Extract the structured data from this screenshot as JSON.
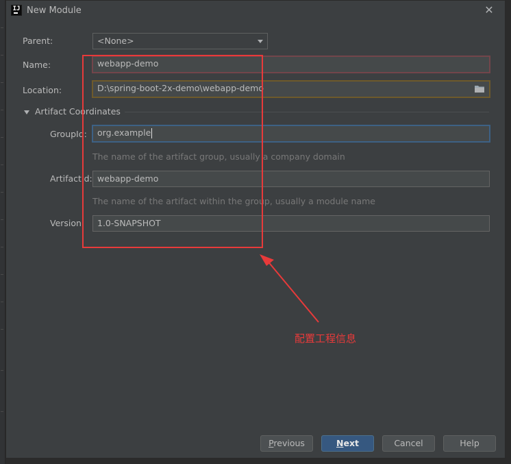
{
  "window": {
    "title": "New Module"
  },
  "form": {
    "parent_label": "Parent:",
    "parent_value": "<None>",
    "name_label": "Name:",
    "name_value": "webapp-demo",
    "location_label": "Location:",
    "location_value": "D:\\spring-boot-2x-demo\\webapp-demo",
    "section_title": "Artifact Coordinates",
    "groupid_label": "GroupId:",
    "groupid_value": "org.example",
    "groupid_hint": "The name of the artifact group, usually a company domain",
    "artifactid_label": "ArtifactId:",
    "artifactid_value": "webapp-demo",
    "artifactid_hint": "The name of the artifact within the group, usually a module name",
    "version_label": "Version:",
    "version_value": "1.0-SNAPSHOT"
  },
  "buttons": {
    "previous_mnemonic": "P",
    "previous_rest": "revious",
    "next_mnemonic": "N",
    "next_rest": "ext",
    "cancel": "Cancel",
    "help": "Help"
  },
  "annotation": {
    "text": "配置工程信息",
    "color": "#e83a3a"
  },
  "icons": {
    "app": "intellij-icon",
    "close": "close-icon",
    "folder": "folder-icon",
    "dropdown": "chevron-down-icon",
    "collapse": "triangle-down-icon"
  },
  "colors": {
    "dialog_bg": "#3c3f41",
    "field_bg": "#45494a",
    "error_border": "#73454b",
    "focus_border": "#3d6185",
    "default_button": "#365880"
  }
}
